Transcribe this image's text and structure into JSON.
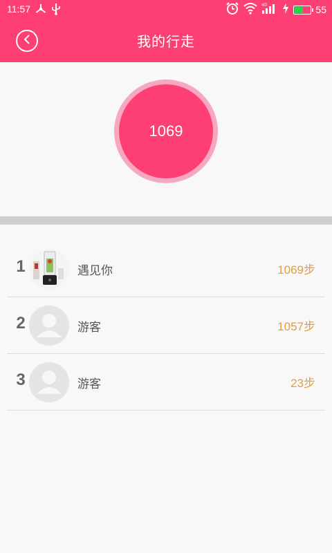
{
  "status_bar": {
    "time": "11:57",
    "battery": "55",
    "battery_level": 0.55,
    "battery_color": "#2fd14b",
    "network": "4G"
  },
  "header": {
    "title": "我的行走",
    "back_icon": "chevron-left-icon",
    "background": "#fe3f74"
  },
  "summary": {
    "steps": "1069",
    "circle_color": "#fe3f74",
    "ring_color": "#f6a8c0"
  },
  "ranking": [
    {
      "rank": "1",
      "name": "遇见你",
      "steps": "1069步",
      "avatar": "photo-avatar"
    },
    {
      "rank": "2",
      "name": "游客",
      "steps": "1057步",
      "avatar": "default-avatar"
    },
    {
      "rank": "3",
      "name": "游客",
      "steps": "23步",
      "avatar": "default-avatar"
    }
  ],
  "colors": {
    "steps_text": "#e59d3c",
    "divider": "#cfcfcf"
  }
}
